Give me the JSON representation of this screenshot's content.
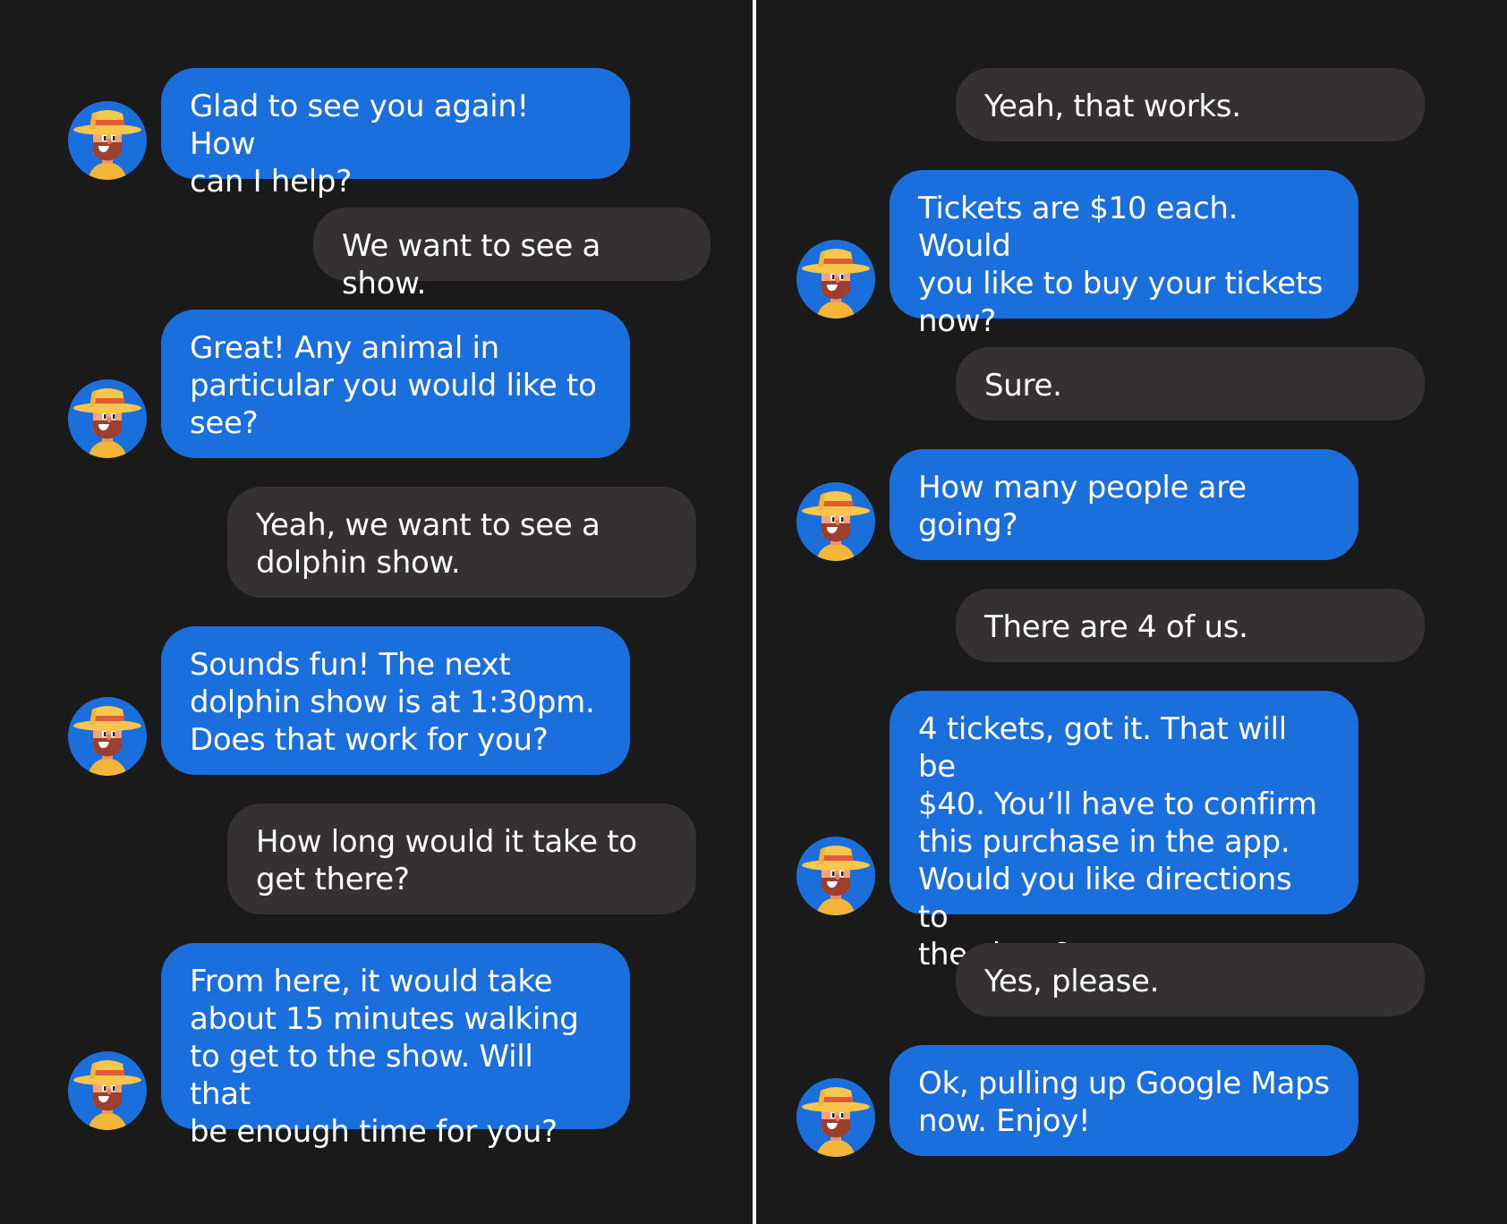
{
  "left_panel": {
    "messages": [
      {
        "sender": "bot",
        "text": "Glad to see you again! How\ncan I help?"
      },
      {
        "sender": "user",
        "text": "We want to see a show."
      },
      {
        "sender": "bot",
        "text": "Great! Any animal in\nparticular you would like to\nsee?"
      },
      {
        "sender": "user",
        "text": "Yeah, we want to see a\ndolphin show."
      },
      {
        "sender": "bot",
        "text": "Sounds fun! The next\ndolphin show is at 1:30pm.\nDoes that work for you?"
      },
      {
        "sender": "user",
        "text": "How long would it take to\nget there?"
      },
      {
        "sender": "bot",
        "text": "From here, it would take\nabout 15 minutes walking\nto get to the show. Will that\nbe enough time for you?"
      }
    ]
  },
  "right_panel": {
    "messages": [
      {
        "sender": "user",
        "text": "Yeah, that works."
      },
      {
        "sender": "bot",
        "text": "Tickets are $10 each. Would\nyou like to buy your tickets\nnow?"
      },
      {
        "sender": "user",
        "text": "Sure."
      },
      {
        "sender": "bot",
        "text": "How many people are\ngoing?"
      },
      {
        "sender": "user",
        "text": "There are 4 of us."
      },
      {
        "sender": "bot",
        "text": "4 tickets, got it. That will be\n$40. You’ll have to confirm\nthis purchase in the app.\nWould you like directions to\nthe show?"
      },
      {
        "sender": "user",
        "text": "Yes, please."
      },
      {
        "sender": "bot",
        "text": "Ok, pulling up Google Maps\nnow. Enjoy!"
      }
    ]
  },
  "colors": {
    "background": "#1a1a1a",
    "bot_bubble": "#1b6fdc",
    "user_bubble": "#353031",
    "divider": "#f2f2f2",
    "text": "#ffffff"
  },
  "icons": {
    "bot_avatar": "explorer-avatar-icon"
  }
}
